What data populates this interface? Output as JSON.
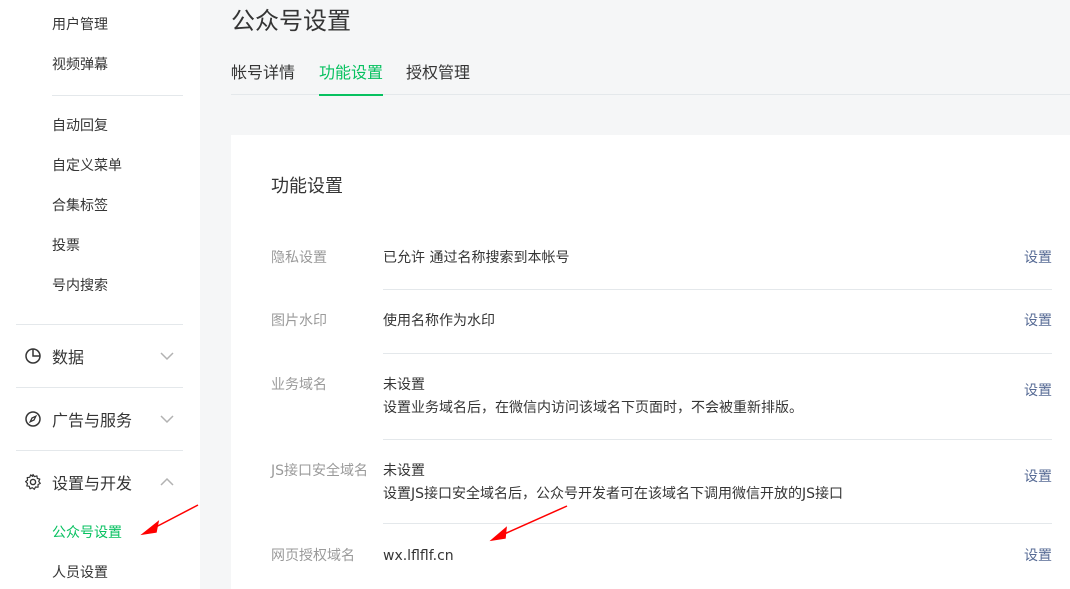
{
  "sidebar": {
    "top_links": [
      "用户管理",
      "视频弹幕"
    ],
    "interaction_links": [
      "自动回复",
      "自定义菜单",
      "合集标签",
      "投票",
      "号内搜索"
    ],
    "groups": [
      {
        "label": "数据",
        "icon": "pie-chart-icon",
        "expanded": false
      },
      {
        "label": "广告与服务",
        "icon": "compass-icon",
        "expanded": false
      },
      {
        "label": "设置与开发",
        "icon": "gear-icon",
        "expanded": true
      }
    ],
    "settings_links": [
      {
        "label": "公众号设置",
        "active": true
      },
      {
        "label": "人员设置",
        "active": false
      }
    ]
  },
  "page": {
    "title": "公众号设置",
    "tabs": [
      {
        "label": "帐号详情",
        "active": false
      },
      {
        "label": "功能设置",
        "active": true
      },
      {
        "label": "授权管理",
        "active": false
      }
    ]
  },
  "card": {
    "title": "功能设置",
    "rows": [
      {
        "label": "隐私设置",
        "lines": [
          "已允许 通过名称搜索到本帐号"
        ],
        "action": "设置"
      },
      {
        "label": "图片水印",
        "lines": [
          "使用名称作为水印"
        ],
        "action": "设置"
      },
      {
        "label": "业务域名",
        "lines": [
          "未设置",
          "设置业务域名后，在微信内访问该域名下页面时，不会被重新排版。"
        ],
        "action": "设置"
      },
      {
        "label": "JS接口安全域名",
        "lines": [
          "未设置",
          "设置JS接口安全域名后，公众号开发者可在该域名下调用微信开放的JS接口"
        ],
        "action": "设置"
      },
      {
        "label": "网页授权域名",
        "lines": [
          "wx.lflflf.cn"
        ],
        "action": "设置"
      }
    ]
  },
  "colors": {
    "accent": "#07c160",
    "link": "#576b95",
    "annotation_arrow": "#ff0000"
  }
}
